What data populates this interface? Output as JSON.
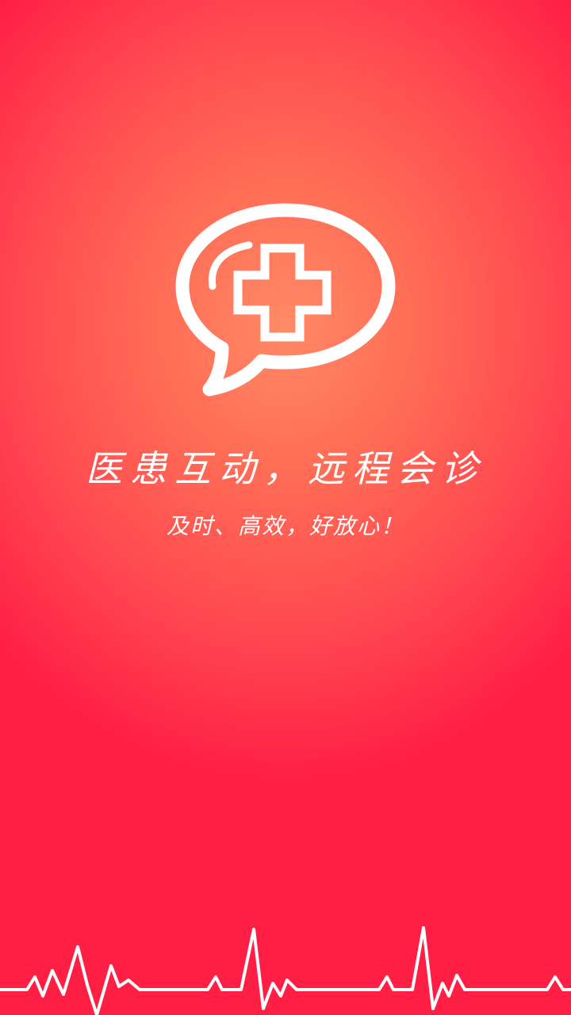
{
  "splash": {
    "slogan": "医患互动，远程会诊",
    "tagline": "及时、高效，好放心！"
  },
  "logo": {
    "icon": "medical-chat-bubble-icon",
    "color": "#ffffff"
  },
  "decor": {
    "icon": "heartbeat-line-icon",
    "color": "#ffffff"
  },
  "theme": {
    "gradient_center": "#ff8a66",
    "gradient_edge": "#ff1f45"
  }
}
